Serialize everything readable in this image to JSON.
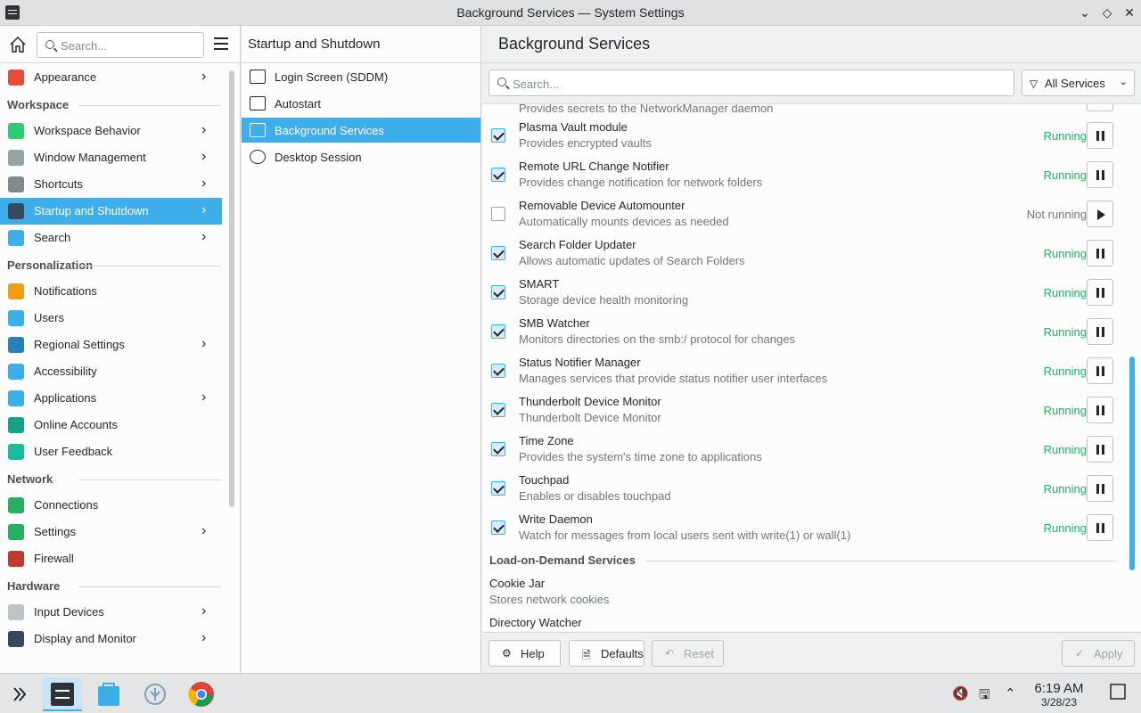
{
  "window": {
    "title": "Background Services — System Settings",
    "minimize_icon": "chevron-down-icon",
    "maximize_icon": "diamond-icon",
    "close_icon": "close-icon"
  },
  "sidebar": {
    "search_placeholder": "Search...",
    "items": [
      {
        "label": "Appearance",
        "icon": "appearance-icon",
        "color": "#e74c3c",
        "chevron": true,
        "active": false
      },
      {
        "section": "Workspace"
      },
      {
        "label": "Workspace Behavior",
        "icon": "workspace-behavior-icon",
        "color": "#2ecc71",
        "chevron": true,
        "active": false
      },
      {
        "label": "Window Management",
        "icon": "window-management-icon",
        "color": "#95a5a6",
        "chevron": true,
        "active": false
      },
      {
        "label": "Shortcuts",
        "icon": "keyboard-icon",
        "color": "#7f8c8d",
        "chevron": true,
        "active": false
      },
      {
        "label": "Startup and Shutdown",
        "icon": "startup-icon",
        "color": "#34495e",
        "chevron": true,
        "active": true
      },
      {
        "label": "Search",
        "icon": "search-icon",
        "color": "#3daee9",
        "chevron": true,
        "active": false
      },
      {
        "section": "Personalization"
      },
      {
        "label": "Notifications",
        "icon": "bell-icon",
        "color": "#f39c12",
        "chevron": false,
        "active": false
      },
      {
        "label": "Users",
        "icon": "users-icon",
        "color": "#3daee9",
        "chevron": false,
        "active": false
      },
      {
        "label": "Regional Settings",
        "icon": "flag-icon",
        "color": "#2980b9",
        "chevron": true,
        "active": false
      },
      {
        "label": "Accessibility",
        "icon": "accessibility-icon",
        "color": "#3daee9",
        "chevron": false,
        "active": false
      },
      {
        "label": "Applications",
        "icon": "applications-icon",
        "color": "#3daee9",
        "chevron": true,
        "active": false
      },
      {
        "label": "Online Accounts",
        "icon": "online-accounts-icon",
        "color": "#16a085",
        "chevron": false,
        "active": false
      },
      {
        "label": "User Feedback",
        "icon": "feedback-icon",
        "color": "#1abc9c",
        "chevron": false,
        "active": false
      },
      {
        "section": "Network"
      },
      {
        "label": "Connections",
        "icon": "globe-icon",
        "color": "#27ae60",
        "chevron": false,
        "active": false
      },
      {
        "label": "Settings",
        "icon": "globe-settings-icon",
        "color": "#27ae60",
        "chevron": true,
        "active": false
      },
      {
        "label": "Firewall",
        "icon": "firewall-icon",
        "color": "#c0392b",
        "chevron": false,
        "active": false
      },
      {
        "section": "Hardware"
      },
      {
        "label": "Input Devices",
        "icon": "mouse-icon",
        "color": "#bdc3c7",
        "chevron": true,
        "active": false
      },
      {
        "label": "Display and Monitor",
        "icon": "monitor-icon",
        "color": "#34495e",
        "chevron": true,
        "active": false
      }
    ]
  },
  "middle": {
    "title": "Startup and Shutdown",
    "items": [
      {
        "label": "Login Screen (SDDM)",
        "icon": "login-screen-icon",
        "active": false
      },
      {
        "label": "Autostart",
        "icon": "autostart-icon",
        "active": false
      },
      {
        "label": "Background Services",
        "icon": "background-services-icon",
        "active": true
      },
      {
        "label": "Desktop Session",
        "icon": "desktop-session-icon",
        "active": false
      }
    ]
  },
  "main": {
    "title": "Background Services",
    "search_placeholder": "Search...",
    "filter_label": "All Services",
    "partial_desc": "Provides secrets to the NetworkManager daemon",
    "services": [
      {
        "name": "Plasma Vault module",
        "desc": "Provides encrypted vaults",
        "enabled": true,
        "status": "Running"
      },
      {
        "name": "Remote URL Change Notifier",
        "desc": "Provides change notification for network folders",
        "enabled": true,
        "status": "Running"
      },
      {
        "name": "Removable Device Automounter",
        "desc": "Automatically mounts devices as needed",
        "enabled": false,
        "status": "Not running"
      },
      {
        "name": "Search Folder Updater",
        "desc": "Allows automatic updates of Search Folders",
        "enabled": true,
        "status": "Running"
      },
      {
        "name": "SMART",
        "desc": "Storage device health monitoring",
        "enabled": true,
        "status": "Running"
      },
      {
        "name": "SMB Watcher",
        "desc": "Monitors directories on the smb:/ protocol for changes",
        "enabled": true,
        "status": "Running"
      },
      {
        "name": "Status Notifier Manager",
        "desc": "Manages services that provide status notifier user interfaces",
        "enabled": true,
        "status": "Running"
      },
      {
        "name": "Thunderbolt Device Monitor",
        "desc": "Thunderbolt Device Monitor",
        "enabled": true,
        "status": "Running"
      },
      {
        "name": "Time Zone",
        "desc": "Provides the system's time zone to applications",
        "enabled": true,
        "status": "Running"
      },
      {
        "name": "Touchpad",
        "desc": "Enables or disables touchpad",
        "enabled": true,
        "status": "Running"
      },
      {
        "name": "Write Daemon",
        "desc": "Watch for messages from local users sent with write(1) or wall(1)",
        "enabled": true,
        "status": "Running"
      }
    ],
    "lod_section": "Load-on-Demand Services",
    "lod_services": [
      {
        "name": "Cookie Jar",
        "desc": "Stores network cookies"
      },
      {
        "name": "Directory Watcher",
        "desc": ""
      }
    ],
    "buttons": {
      "help": "Help",
      "defaults": "Defaults",
      "reset": "Reset",
      "apply": "Apply"
    }
  },
  "taskbar": {
    "time": "6:19 AM",
    "date": "3/28/23",
    "apps": [
      "app-launcher-icon",
      "system-settings-icon",
      "discover-icon",
      "kde-connect-icon",
      "chrome-icon"
    ],
    "tray": [
      "volume-muted-icon",
      "network-icon",
      "tray-expand-icon"
    ]
  }
}
